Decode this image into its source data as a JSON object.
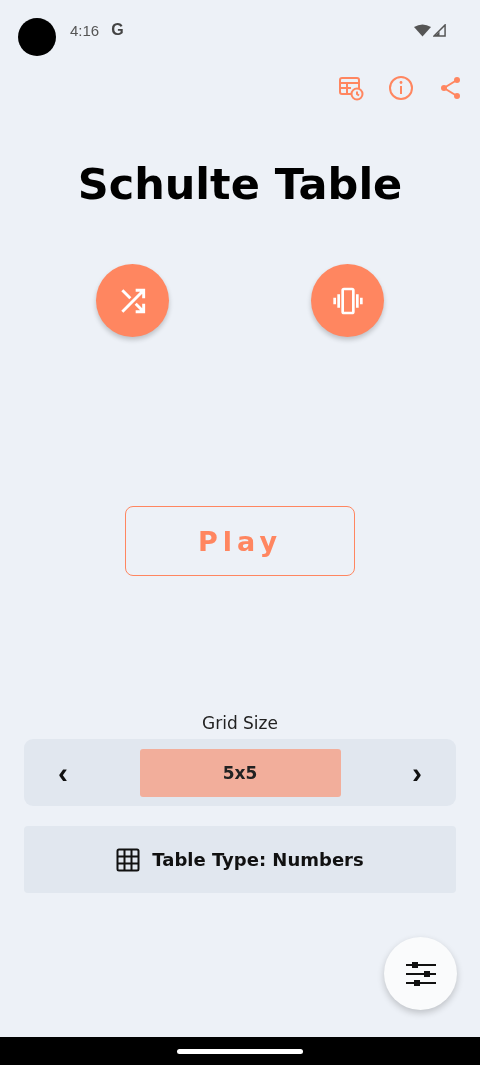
{
  "status_bar": {
    "time": "4:16",
    "notification": "G"
  },
  "title": "Schulte Table",
  "play_button": {
    "label": "Play"
  },
  "grid_size": {
    "label": "Grid Size",
    "value": "5x5",
    "prev": "‹",
    "next": "›"
  },
  "table_type": {
    "label": "Table Type: Numbers"
  }
}
